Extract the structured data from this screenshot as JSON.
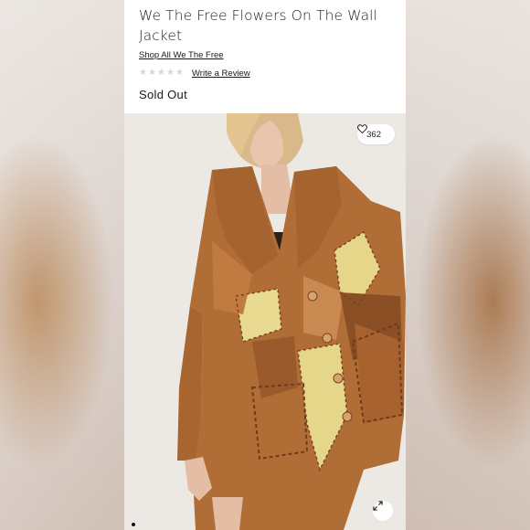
{
  "product": {
    "title_line1": "We The Free Flowers On The Wall",
    "title_line2": "Jacket",
    "shop_link": "Shop All We The Free",
    "review_link": "Write a Review",
    "status": "Sold Out",
    "rating_stars": 5
  },
  "gallery": {
    "like_count": "362",
    "like_icon": "heart-outline-icon",
    "zoom_icon": "expand-icon",
    "current_slide_indicator": "carousel-dot"
  },
  "colors": {
    "suede_brown": "#b06d36",
    "suede_dark": "#8a4f25",
    "patch_yellow": "#e6d68a",
    "background": "#ffffff"
  }
}
